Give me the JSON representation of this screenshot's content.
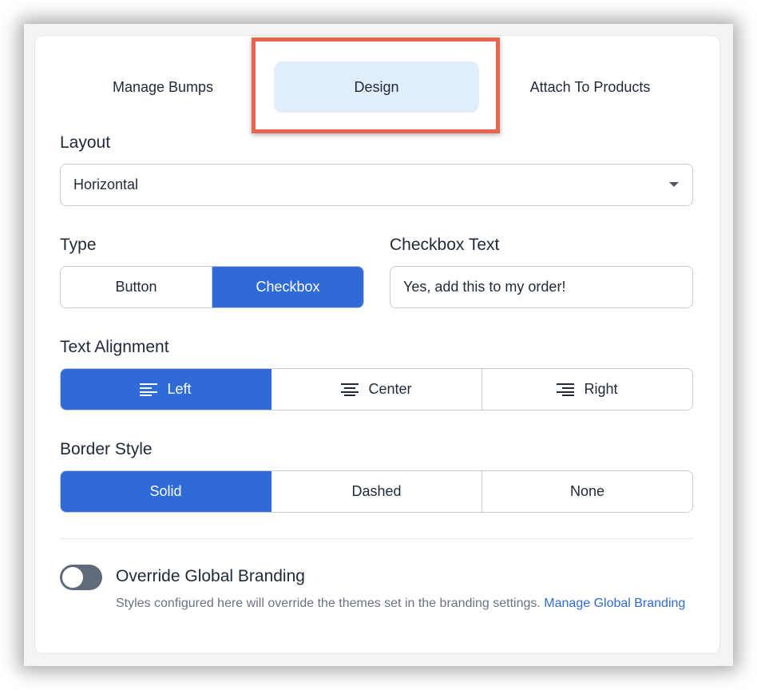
{
  "tabs": {
    "manage_bumps": "Manage Bumps",
    "design": "Design",
    "attach_to_products": "Attach To Products",
    "active": "Design"
  },
  "layout": {
    "label": "Layout",
    "selected": "Horizontal"
  },
  "type": {
    "label": "Type",
    "options": [
      "Button",
      "Checkbox"
    ],
    "selected": "Checkbox"
  },
  "checkbox_text": {
    "label": "Checkbox Text",
    "value": "Yes, add this to my order!"
  },
  "text_alignment": {
    "label": "Text Alignment",
    "options": [
      "Left",
      "Center",
      "Right"
    ],
    "icons": [
      "align-left-icon",
      "align-center-icon",
      "align-right-icon"
    ],
    "selected": "Left"
  },
  "border_style": {
    "label": "Border Style",
    "options": [
      "Solid",
      "Dashed",
      "None"
    ],
    "selected": "Solid"
  },
  "override": {
    "title": "Override Global Branding",
    "enabled": false,
    "help_text": "Styles configured here will override the themes set in the branding settings.",
    "link_text": "Manage Global Branding"
  },
  "colors": {
    "accent": "#2f6bd6",
    "tab_active_bg": "#e1effc",
    "highlight_border": "#e8664e",
    "toggle_off": "#5f6b7b"
  }
}
